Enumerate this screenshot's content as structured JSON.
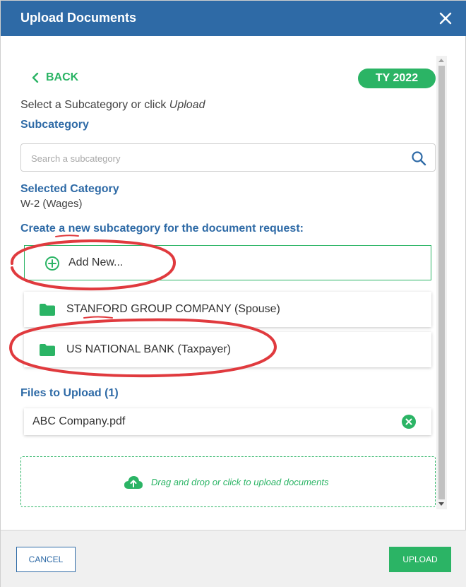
{
  "window": {
    "title": "Upload Documents",
    "close_icon": "close-icon"
  },
  "nav": {
    "back_label": "BACK",
    "tax_year_badge": "TY 2022"
  },
  "instruction": {
    "prefix": "Select a Subcategory or click ",
    "emphasis": "Upload"
  },
  "subcategory": {
    "heading": "Subcategory",
    "search_placeholder": "Search a subcategory",
    "search_value": ""
  },
  "selected_category": {
    "heading": "Selected Category",
    "value": "W-2 (Wages)"
  },
  "create_section": {
    "heading": "Create a new subcategory for the document request:",
    "add_new_label": "Add New...",
    "subcategories": [
      {
        "label": "STANFORD GROUP COMPANY (Spouse)",
        "icon": "folder-icon"
      },
      {
        "label": "US NATIONAL BANK (Taxpayer)",
        "icon": "folder-icon"
      }
    ]
  },
  "files": {
    "heading": "Files to Upload (1)",
    "items": [
      {
        "name": "ABC Company.pdf"
      }
    ]
  },
  "dropzone": {
    "label": "Drag and drop or click to upload documents"
  },
  "footer": {
    "cancel_label": "CANCEL",
    "upload_label": "UPLOAD"
  },
  "colors": {
    "header_blue": "#2e6aa6",
    "accent_green": "#2bb465",
    "annotation_red": "#e03a3e"
  }
}
